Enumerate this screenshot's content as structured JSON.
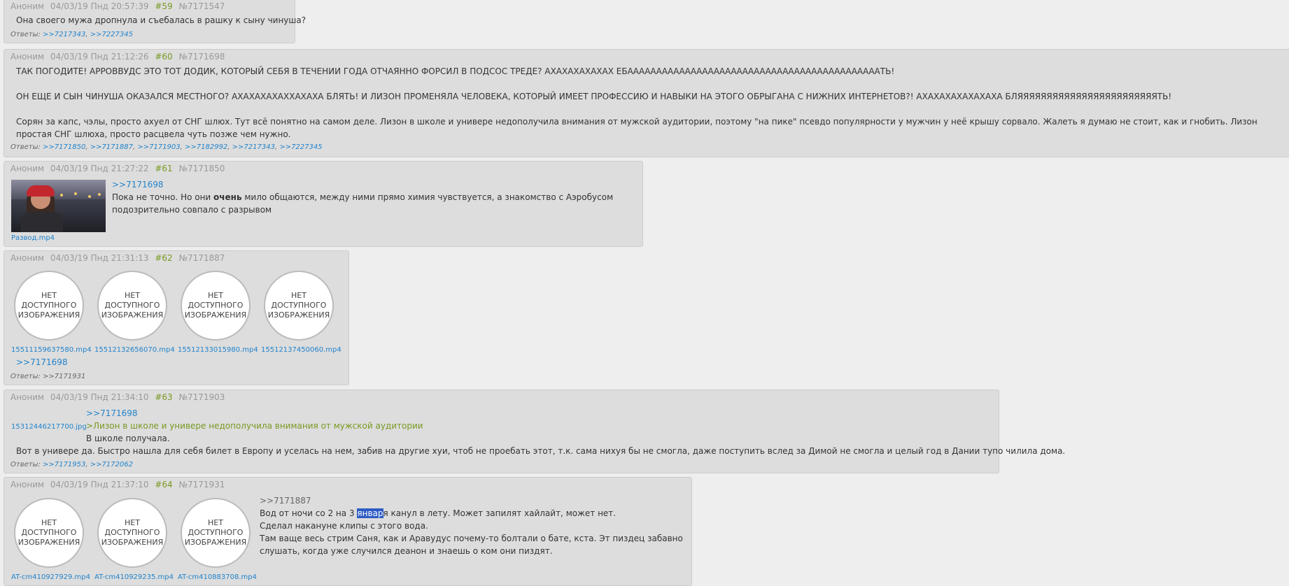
{
  "posts": [
    {
      "author": "Аноним",
      "date": "04/03/19 Пнд 20:57:39",
      "num": "#59",
      "id": "№7171547",
      "text": "Она своего мужа дропнула и съебалась в рашку к сыну чинуша?",
      "replies_label": "Ответы:",
      "replies": [
        ">>7217343",
        ">>7227345"
      ]
    },
    {
      "author": "Аноним",
      "date": "04/03/19 Пнд 21:12:26",
      "num": "#60",
      "id": "№7171698",
      "lines": [
        "ТАК ПОГОДИТЕ! АРРОВВУДС ЭТО ТОТ ДОДИК, КОТОРЫЙ СЕБЯ В ТЕЧЕНИИ ГОДА ОТЧАЯННО ФОРСИЛ В ПОДСОС ТРЕДЕ? АХАХАХАХАХАХ ЕБААААААААААААААААААААААААААААААААААААААААААААТЬ!",
        "ОН ЕЩЕ И СЫН ЧИНУША ОКАЗАЛСЯ МЕСТНОГО? АХАХАХАХАХХАХАХА БЛЯТЬ! И ЛИЗОН ПРОМЕНЯЛА ЧЕЛОВЕКА, КОТОРЫЙ ИМЕЕТ ПРОФЕССИЮ И НАВЫКИ НА ЭТОГО ОБРЫГАНА С НИЖНИХ ИНТЕРНЕТОВ?! АХАХАХАХАХАХАХА БЛЯЯЯЯЯЯЯЯЯЯЯЯЯЯЯЯЯЯЯЯЯЯЯЯТЬ!",
        "Сорян за капс, чэлы, просто ахуел от СНГ шлюх. Тут всё понятно на самом деле. Лизон в школе и универе недополучила внимания от мужской аудитории, поэтому \"на пике\" псевдо популярности у мужчин у неё крышу сорвало. Жалеть я думаю не стоит, как и гнобить. Лизон простая СНГ шлюха, просто расцвела чуть позже чем нужно."
      ],
      "replies_label": "Ответы:",
      "replies": [
        ">>7171850",
        ">>7171887",
        ">>7171903",
        ">>7182992",
        ">>7217343",
        ">>7227345"
      ]
    },
    {
      "author": "Аноним",
      "date": "04/03/19 Пнд 21:27:22",
      "num": "#61",
      "id": "№7171850",
      "file": "Развод.mp4",
      "reply_link": ">>7171698",
      "text_pre": "Пока не точно. Но они ",
      "text_bold": "очень",
      "text_post": " мило общаются, между ними прямо химия чувствуется, а знакомство с Аэробусом",
      "text_line2": "подозрительно совпало с разрывом"
    },
    {
      "author": "Аноним",
      "date": "04/03/19 Пнд 21:31:13",
      "num": "#62",
      "id": "№7171887",
      "noimg": "НЕТ ДОСТУПНОГО ИЗОБРАЖЕНИЯ",
      "noimg_l1": "НЕТ",
      "noimg_l2": "ДОСТУПНОГО",
      "noimg_l3": "ИЗОБРАЖЕНИЯ",
      "files": [
        "15511159637580.mp4",
        "15512132656070.mp4",
        "15512133015980.mp4",
        "15512137450060.mp4"
      ],
      "reply_link": ">>7171698",
      "replies_label": "Ответы:",
      "replies": [
        ">>7171931"
      ]
    },
    {
      "author": "Аноним",
      "date": "04/03/19 Пнд 21:34:10",
      "num": "#63",
      "id": "№7171903",
      "file": "15312446217700.jpg",
      "reply_link": ">>7171698",
      "quote": ">Лизон в школе и универе недополучила внимания от мужской аудитории",
      "line1": "В школе получала.",
      "line2": "Вот в универе да. Быстро нашла для себя билет в Европу и уселась на нем, забив на другие хуи, чтоб не проебать этот, т.к. сама нихуя бы не смогла, даже поступить вслед за Димой не смогла и целый год в Дании тупо чилила дома.",
      "replies_label": "Ответы:",
      "replies": [
        ">>7171953",
        ">>7172062"
      ]
    },
    {
      "author": "Аноним",
      "date": "04/03/19 Пнд 21:37:10",
      "num": "#64",
      "id": "№7171931",
      "files": [
        "AT-cm410927929.mp4",
        "AT-cm410929235.mp4",
        "AT-cm410883708.mp4"
      ],
      "reply_link": ">>7171887",
      "l1_pre": "Вод от ночи со 2 на 3 ",
      "l1_sel": "январ",
      "l1_post": "я канул в лету. Может запилят хайлайт, может нет.",
      "l2": "Сделал накануне клипы с этого вода.",
      "l3": "Там ваще весь стрим Саня, как и Аравудус почему-то болтали о бате, кста. Эт пиздец забавно",
      "l4": "слушать, когда уже случился деанон и знаешь о ком они пиздят."
    }
  ]
}
